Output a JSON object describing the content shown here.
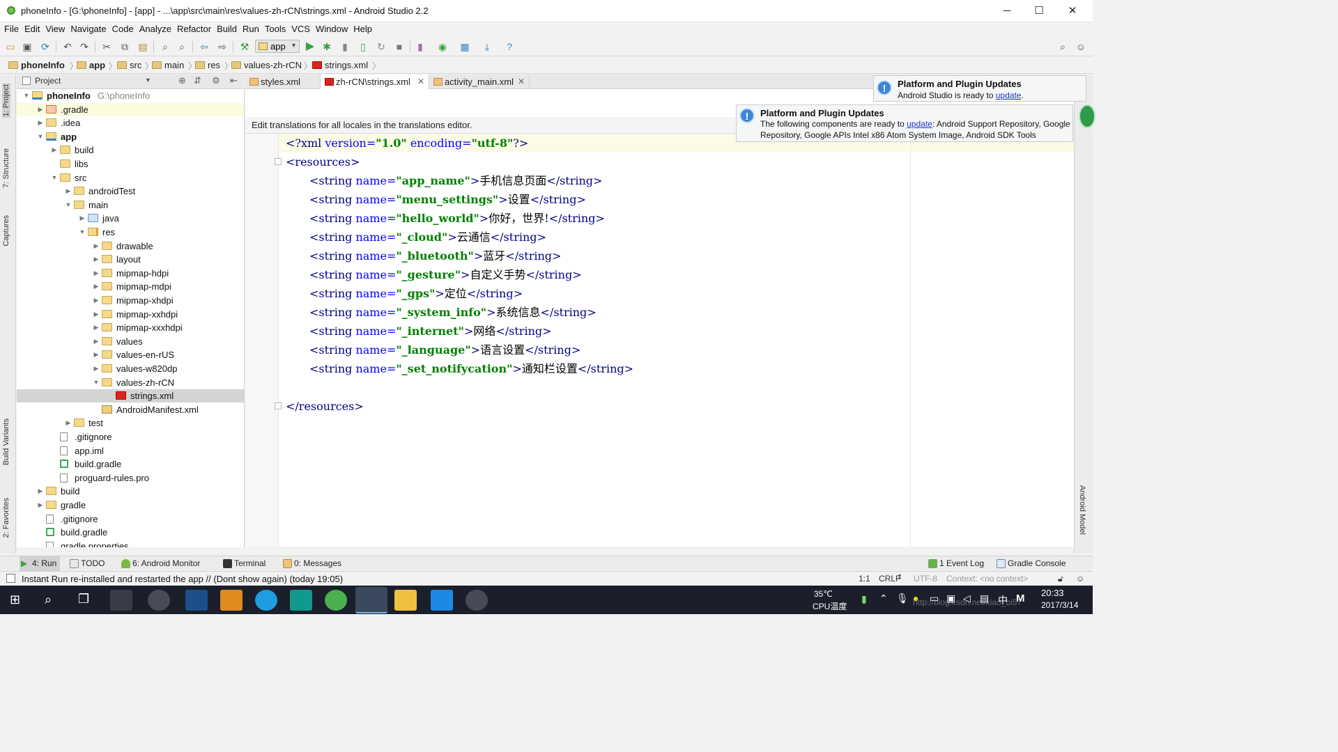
{
  "window": {
    "title": "phoneInfo - [G:\\phoneInfo] - [app] - ...\\app\\src\\main\\res\\values-zh-rCN\\strings.xml - Android Studio 2.2",
    "controls": [
      "─",
      "☐",
      "✕"
    ]
  },
  "menu": [
    "File",
    "Edit",
    "View",
    "Navigate",
    "Code",
    "Analyze",
    "Refactor",
    "Build",
    "Run",
    "Tools",
    "VCS",
    "Window",
    "Help"
  ],
  "toolbar": {
    "run_config": "app"
  },
  "breadcrumb": [
    "phoneInfo",
    "app",
    "src",
    "main",
    "res",
    "values-zh-rCN",
    "strings.xml"
  ],
  "left_tool_tabs": [
    "1: Project",
    "7: Structure",
    "Captures",
    "Build Variants",
    "2: Favorites"
  ],
  "right_tool_tabs": [
    "Android Model"
  ],
  "project_panel": {
    "selector": "Project",
    "tree": [
      {
        "label": "phoneInfo",
        "path": "G:\\phoneInfo",
        "depth": 0,
        "arrow": "▼",
        "kind": "module",
        "bold": true
      },
      {
        "label": ".gradle",
        "depth": 1,
        "arrow": "▶",
        "kind": "folder-red",
        "highlight": true
      },
      {
        "label": ".idea",
        "depth": 1,
        "arrow": "▶",
        "kind": "folder"
      },
      {
        "label": "app",
        "depth": 1,
        "arrow": "▼",
        "kind": "module",
        "bold": true
      },
      {
        "label": "build",
        "depth": 2,
        "arrow": "▶",
        "kind": "folder"
      },
      {
        "label": "libs",
        "depth": 2,
        "arrow": "",
        "kind": "folder"
      },
      {
        "label": "src",
        "depth": 2,
        "arrow": "▼",
        "kind": "folder"
      },
      {
        "label": "androidTest",
        "depth": 3,
        "arrow": "▶",
        "kind": "folder"
      },
      {
        "label": "main",
        "depth": 3,
        "arrow": "▼",
        "kind": "folder"
      },
      {
        "label": "java",
        "depth": 4,
        "arrow": "▶",
        "kind": "folder-blue"
      },
      {
        "label": "res",
        "depth": 4,
        "arrow": "▼",
        "kind": "folder-res"
      },
      {
        "label": "drawable",
        "depth": 5,
        "arrow": "▶",
        "kind": "folder"
      },
      {
        "label": "layout",
        "depth": 5,
        "arrow": "▶",
        "kind": "folder"
      },
      {
        "label": "mipmap-hdpi",
        "depth": 5,
        "arrow": "▶",
        "kind": "folder"
      },
      {
        "label": "mipmap-mdpi",
        "depth": 5,
        "arrow": "▶",
        "kind": "folder"
      },
      {
        "label": "mipmap-xhdpi",
        "depth": 5,
        "arrow": "▶",
        "kind": "folder"
      },
      {
        "label": "mipmap-xxhdpi",
        "depth": 5,
        "arrow": "▶",
        "kind": "folder"
      },
      {
        "label": "mipmap-xxxhdpi",
        "depth": 5,
        "arrow": "▶",
        "kind": "folder"
      },
      {
        "label": "values",
        "depth": 5,
        "arrow": "▶",
        "kind": "folder"
      },
      {
        "label": "values-en-rUS",
        "depth": 5,
        "arrow": "▶",
        "kind": "folder"
      },
      {
        "label": "values-w820dp",
        "depth": 5,
        "arrow": "▶",
        "kind": "folder"
      },
      {
        "label": "values-zh-rCN",
        "depth": 5,
        "arrow": "▼",
        "kind": "folder"
      },
      {
        "label": "strings.xml",
        "depth": 6,
        "arrow": "",
        "kind": "flag",
        "selected": true
      },
      {
        "label": "AndroidManifest.xml",
        "depth": 5,
        "arrow": "",
        "kind": "manifest"
      },
      {
        "label": "test",
        "depth": 3,
        "arrow": "▶",
        "kind": "folder"
      },
      {
        "label": ".gitignore",
        "depth": 2,
        "arrow": "",
        "kind": "file"
      },
      {
        "label": "app.iml",
        "depth": 2,
        "arrow": "",
        "kind": "file"
      },
      {
        "label": "build.gradle",
        "depth": 2,
        "arrow": "",
        "kind": "gradle"
      },
      {
        "label": "proguard-rules.pro",
        "depth": 2,
        "arrow": "",
        "kind": "file"
      },
      {
        "label": "build",
        "depth": 1,
        "arrow": "▶",
        "kind": "folder"
      },
      {
        "label": "gradle",
        "depth": 1,
        "arrow": "▶",
        "kind": "folder"
      },
      {
        "label": ".gitignore",
        "depth": 1,
        "arrow": "",
        "kind": "file"
      },
      {
        "label": "build.gradle",
        "depth": 1,
        "arrow": "",
        "kind": "gradle"
      },
      {
        "label": "gradle.properties",
        "depth": 1,
        "arrow": "",
        "kind": "file"
      }
    ]
  },
  "editor_tabs": [
    {
      "label": "styles.xml",
      "active": false
    },
    {
      "label": "zh-rCN\\strings.xml",
      "active": true
    },
    {
      "label": "activity_main.xml",
      "active": false
    }
  ],
  "editor": {
    "banner": "Edit translations for all locales in the translations editor.",
    "lines": [
      {
        "indent": 0,
        "parts": [
          [
            "tag",
            "<?xml "
          ],
          [
            "attr",
            "version="
          ],
          [
            "val",
            "\"1.0\""
          ],
          [
            "attr",
            " encoding="
          ],
          [
            "val",
            "\"utf-8\""
          ],
          [
            "tag",
            "?>"
          ]
        ]
      },
      {
        "indent": 0,
        "parts": [
          [
            "tag",
            "<resources>"
          ]
        ]
      },
      {
        "indent": 1,
        "parts": [
          [
            "tag",
            "<string "
          ],
          [
            "attr",
            "name="
          ],
          [
            "val",
            "\"app_name\""
          ],
          [
            "tag",
            ">"
          ],
          [
            "txt",
            "手机信息页面"
          ],
          [
            "tag",
            "</string>"
          ]
        ]
      },
      {
        "indent": 1,
        "parts": [
          [
            "tag",
            "<string "
          ],
          [
            "attr",
            "name="
          ],
          [
            "val",
            "\"menu_settings\""
          ],
          [
            "tag",
            ">"
          ],
          [
            "txt",
            "设置"
          ],
          [
            "tag",
            "</string>"
          ]
        ]
      },
      {
        "indent": 1,
        "parts": [
          [
            "tag",
            "<string "
          ],
          [
            "attr",
            "name="
          ],
          [
            "val",
            "\"hello_world\""
          ],
          [
            "tag",
            ">"
          ],
          [
            "txt",
            "你好，世界!"
          ],
          [
            "tag",
            "</string>"
          ]
        ]
      },
      {
        "indent": 1,
        "parts": [
          [
            "tag",
            "<string "
          ],
          [
            "attr",
            "name="
          ],
          [
            "val",
            "\"_cloud\""
          ],
          [
            "tag",
            ">"
          ],
          [
            "txt",
            "云通信"
          ],
          [
            "tag",
            "</string>"
          ]
        ]
      },
      {
        "indent": 1,
        "parts": [
          [
            "tag",
            "<string "
          ],
          [
            "attr",
            "name="
          ],
          [
            "val",
            "\"_bluetooth\""
          ],
          [
            "tag",
            ">"
          ],
          [
            "txt",
            "蓝牙"
          ],
          [
            "tag",
            "</string>"
          ]
        ]
      },
      {
        "indent": 1,
        "parts": [
          [
            "tag",
            "<string "
          ],
          [
            "attr",
            "name="
          ],
          [
            "val",
            "\"_gesture\""
          ],
          [
            "tag",
            ">"
          ],
          [
            "txt",
            "自定义手势"
          ],
          [
            "tag",
            "</string>"
          ]
        ]
      },
      {
        "indent": 1,
        "parts": [
          [
            "tag",
            "<string "
          ],
          [
            "attr",
            "name="
          ],
          [
            "val",
            "\"_gps\""
          ],
          [
            "tag",
            ">"
          ],
          [
            "txt",
            "定位"
          ],
          [
            "tag",
            "</string>"
          ]
        ]
      },
      {
        "indent": 1,
        "parts": [
          [
            "tag",
            "<string "
          ],
          [
            "attr",
            "name="
          ],
          [
            "val",
            "\"_system_info\""
          ],
          [
            "tag",
            ">"
          ],
          [
            "txt",
            "系统信息"
          ],
          [
            "tag",
            "</string>"
          ]
        ]
      },
      {
        "indent": 1,
        "parts": [
          [
            "tag",
            "<string "
          ],
          [
            "attr",
            "name="
          ],
          [
            "val",
            "\"_internet\""
          ],
          [
            "tag",
            ">"
          ],
          [
            "txt",
            "网络"
          ],
          [
            "tag",
            "</string>"
          ]
        ]
      },
      {
        "indent": 1,
        "parts": [
          [
            "tag",
            "<string "
          ],
          [
            "attr",
            "name="
          ],
          [
            "val",
            "\"_language\""
          ],
          [
            "tag",
            ">"
          ],
          [
            "txt",
            "语言设置"
          ],
          [
            "tag",
            "</string>"
          ]
        ]
      },
      {
        "indent": 1,
        "parts": [
          [
            "tag",
            "<string "
          ],
          [
            "attr",
            "name="
          ],
          [
            "val",
            "\"_set_notifycation\""
          ],
          [
            "tag",
            ">"
          ],
          [
            "txt",
            "通知栏设置"
          ],
          [
            "tag",
            "</string>"
          ]
        ]
      },
      {
        "indent": 0,
        "parts": []
      },
      {
        "indent": 0,
        "parts": [
          [
            "tag",
            "</resources>"
          ]
        ]
      }
    ]
  },
  "notifications": [
    {
      "title": "Platform and Plugin Updates",
      "body_prefix": "Android Studio is ready to ",
      "link": "update",
      "body_suffix": "."
    },
    {
      "title": "Platform and Plugin Updates",
      "body_prefix": "The following components are ready to ",
      "link": "update",
      "body_suffix": ": Android Support Repository, Google Repository, Google APIs Intel x86 Atom System Image, Android SDK Tools"
    }
  ],
  "bottom_tabs": [
    {
      "label": "4: Run",
      "active": true
    },
    {
      "label": "TODO",
      "active": false
    },
    {
      "label": "6: Android Monitor",
      "active": false
    },
    {
      "label": "Terminal",
      "active": false
    },
    {
      "label": "0: Messages",
      "active": false
    }
  ],
  "bottom_right_tabs": [
    "1 Event Log",
    "Gradle Console"
  ],
  "statusbar": {
    "message": "Instant Run re-installed and restarted the app // (Dont show again) (today 19:05)",
    "position": "1:1",
    "line_sep": "CRLF",
    "encoding": "UTF-8",
    "context": "Context: <no context>"
  },
  "taskbar": {
    "temp": "35℃",
    "temp_label": "CPU温度",
    "time": "20:33",
    "date": "2017/3/14",
    "ime": "中",
    "watermark": "http://blog.csdn.net/xiao_bi57"
  },
  "colors": {
    "xml_tag": "#000080",
    "xml_attr": "#0000ff",
    "xml_value": "#008000",
    "selection": "#d4d4d4",
    "caret_line": "#fbfbe6",
    "notification_icon": "#3d86d9",
    "taskbar": "#1a1f2b"
  }
}
